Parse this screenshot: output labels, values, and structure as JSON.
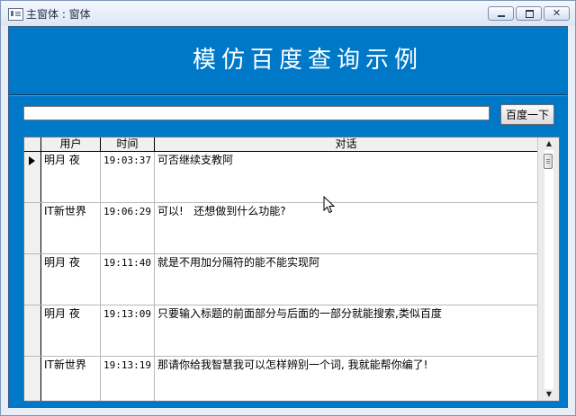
{
  "window": {
    "title": "主窗体 : 窗体",
    "buttons": {
      "minimize": "minimize",
      "maximize": "maximize",
      "close": "close"
    }
  },
  "form": {
    "title": "模仿百度查询示例",
    "search": {
      "value": "",
      "placeholder": ""
    },
    "search_button_label": "百度一下"
  },
  "grid": {
    "columns": [
      "用户",
      "时间",
      "对话"
    ],
    "rows": [
      {
        "user": "明月 夜",
        "time": "19:03:37",
        "message": "可否继续支教阿",
        "current": true
      },
      {
        "user": "IT新世界",
        "time": "19:06:29",
        "message": "可以!   还想做到什么功能?",
        "current": false
      },
      {
        "user": "明月 夜",
        "time": "19:11:40",
        "message": "就是不用加分隔符的能不能实现阿",
        "current": false
      },
      {
        "user": "明月 夜",
        "time": "19:13:09",
        "message": "只要输入标题的前面部分与后面的一部分就能搜索,类似百度",
        "current": false
      },
      {
        "user": "IT新世界",
        "time": "19:13:19",
        "message": "那请你给我智慧我可以怎样辨别一个词, 我就能帮你编了!",
        "current": false
      }
    ]
  },
  "colors": {
    "form_background": "#0078c8",
    "title_text": "#ffffff"
  },
  "icons": {
    "app": "form-window-icon",
    "row_indicator": "current-record-arrow-icon",
    "pointer": "mouse-pointer-icon"
  }
}
